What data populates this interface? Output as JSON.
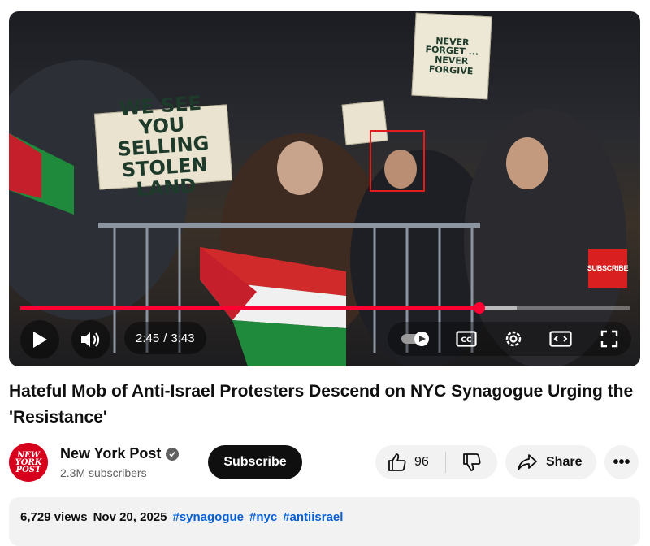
{
  "video": {
    "sign_main": "WE SEE YOU SELLING STOLEN LAND",
    "sign_top_right": "NEVER FORGET ... NEVER FORGIVE",
    "sign_small": "",
    "subscribe_watermark": "SUBSCRIBE",
    "progress": {
      "played_fraction": 0.753,
      "buffered_fraction": 0.814
    },
    "time_current": "2:45",
    "time_separator": "/",
    "time_total": "3:43"
  },
  "title": "Hateful Mob of Anti-Israel Protesters Descend on NYC Synagogue Urging the 'Resistance'",
  "channel": {
    "avatar_text": "NEW YORK POST",
    "name": "New York Post",
    "subscribers": "2.3M subscribers",
    "subscribe_label": "Subscribe"
  },
  "actions": {
    "like_count": "96",
    "share_label": "Share",
    "more_label": "•••"
  },
  "description": {
    "views": "6,729 views",
    "date": "Nov 20, 2025",
    "hashtags": [
      "#synagogue",
      "#nyc",
      "#antiisrael"
    ]
  },
  "colors": {
    "accent_red": "#ff0033",
    "brand_red": "#d6001c",
    "link_blue": "#065fd4"
  },
  "icons": [
    "play-icon",
    "volume-icon",
    "autoplay-toggle-icon",
    "captions-icon",
    "settings-icon",
    "theater-mode-icon",
    "fullscreen-icon",
    "verified-icon",
    "thumbs-up-icon",
    "thumbs-down-icon",
    "share-icon",
    "more-icon"
  ]
}
